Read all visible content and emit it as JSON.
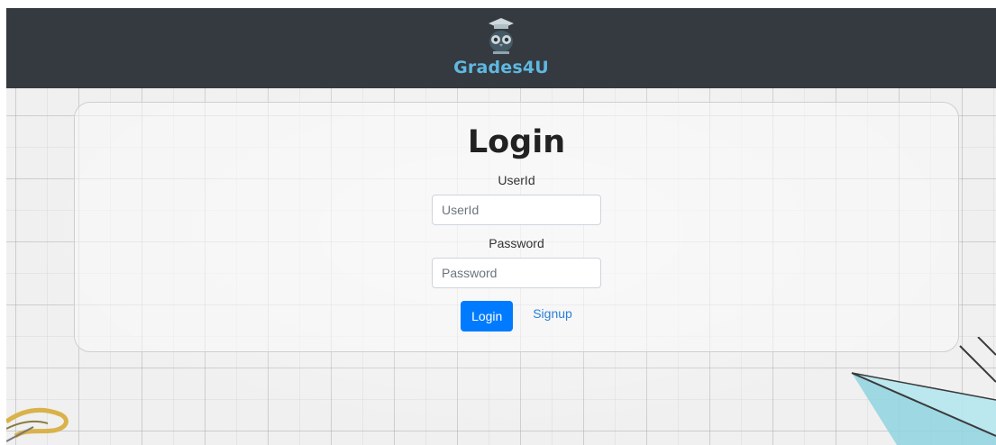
{
  "header": {
    "brand": "Grades4U",
    "logo_icon": "owl-graduate-icon",
    "background_color": "#343a40",
    "brand_color": "#5fb8e0"
  },
  "login": {
    "title": "Login",
    "userid_label": "UserId",
    "userid_placeholder": "UserId",
    "userid_value": "",
    "password_label": "Password",
    "password_placeholder": "Password",
    "password_value": "",
    "login_button": "Login",
    "signup_link": "Signup",
    "accent_color": "#007bff"
  },
  "decorations": {
    "left": "paper-clip-icon",
    "right": "paper-plane-icon"
  }
}
